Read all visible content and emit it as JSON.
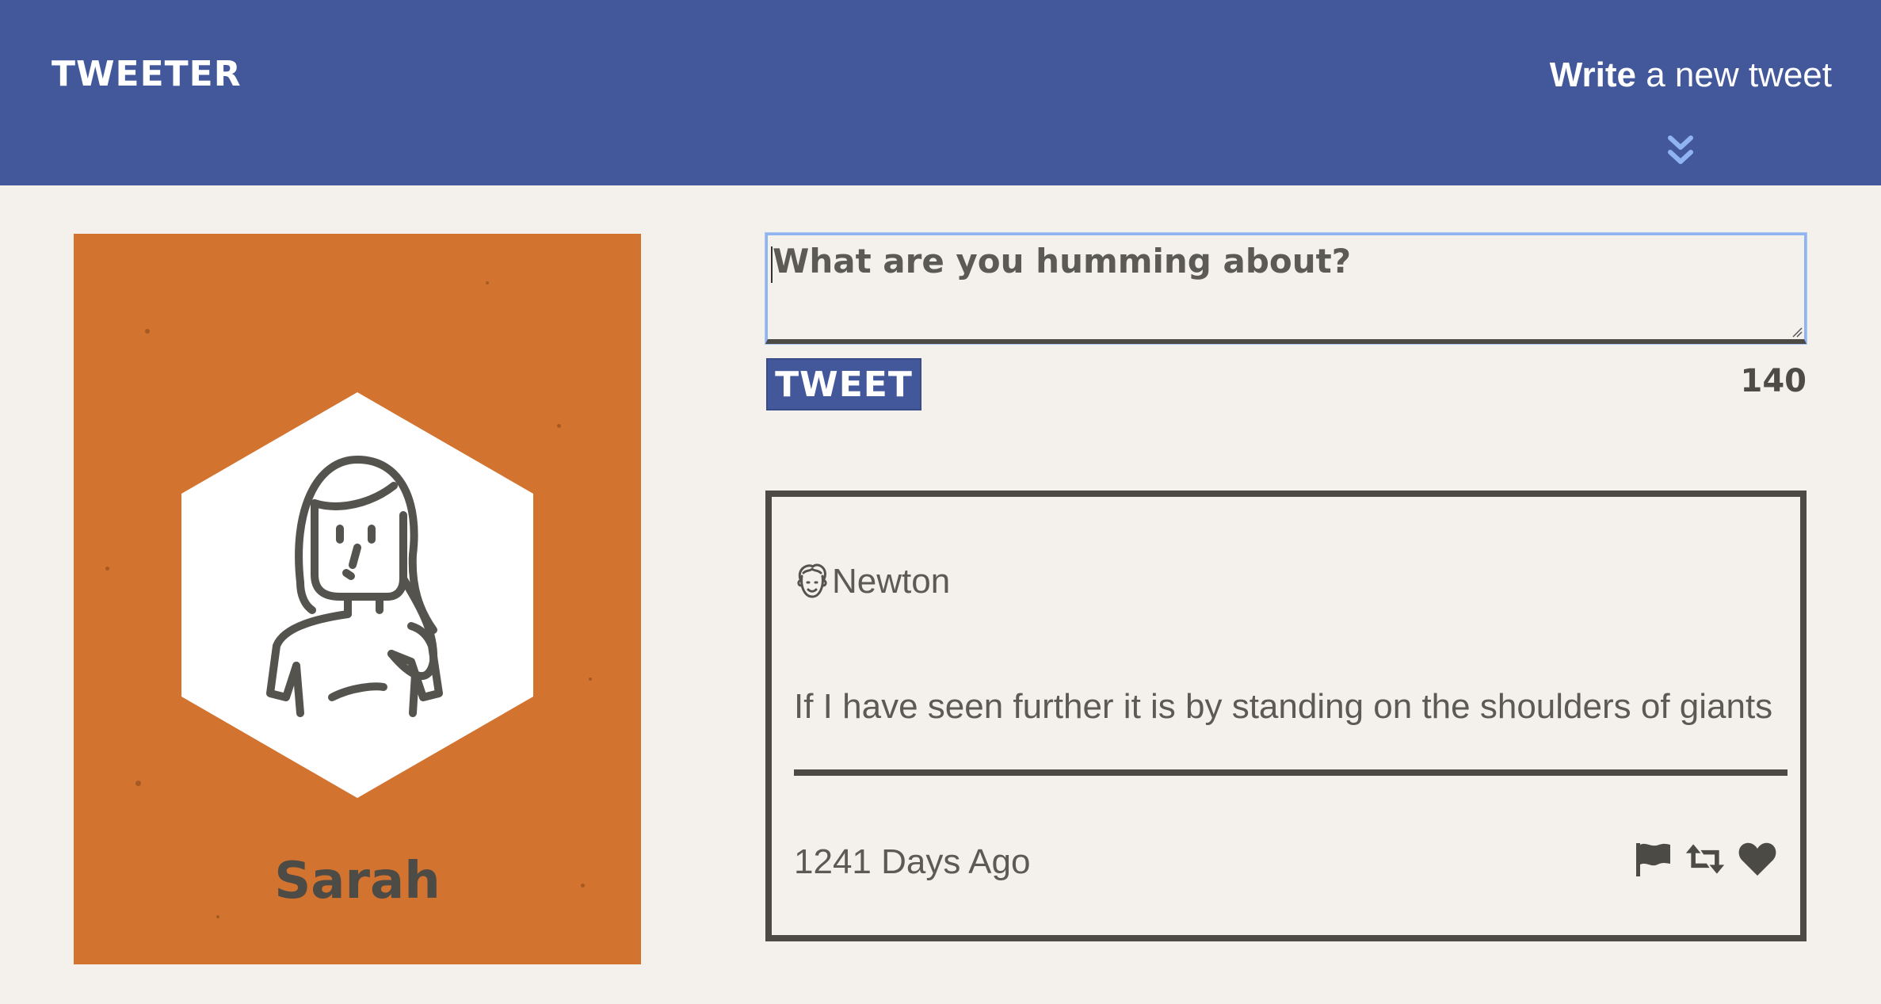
{
  "header": {
    "brand": "TWEETER",
    "compose_toggle_strong": "Write",
    "compose_toggle_rest": "a new tweet",
    "toggle_icon": "double-chevron-down-icon"
  },
  "profile": {
    "name": "Sarah",
    "avatar_icon": "woman-avatar-icon",
    "card_color": "#d27330"
  },
  "composer": {
    "placeholder": "What are you humming about?",
    "value": "",
    "submit_label": "TWEET",
    "char_counter": "140"
  },
  "tweets": [
    {
      "author": "Newton",
      "author_avatar_icon": "man-face-avatar-icon",
      "text": "If I have seen further it is by standing on the shoulders of giants",
      "timestamp": "1241 Days Ago",
      "actions": [
        "flag-icon",
        "retweet-icon",
        "heart-icon"
      ]
    }
  ],
  "colors": {
    "header_bg": "#43579b",
    "page_bg": "#f4f1ed",
    "text_dark": "#4d4b46",
    "focus_ring": "#8fb4ef"
  }
}
